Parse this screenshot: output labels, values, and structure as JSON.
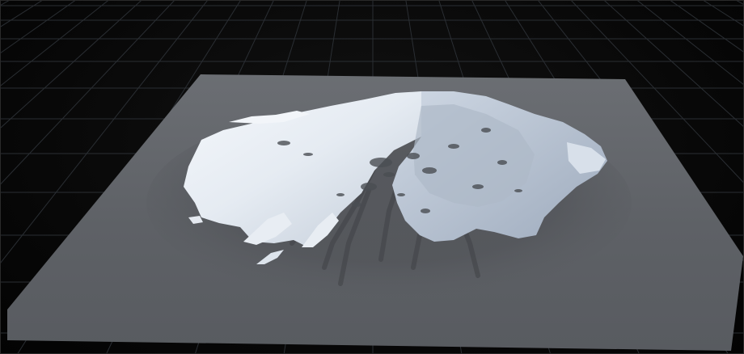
{
  "viewport": {
    "background_color": "#050505",
    "grid_color": "#2a2e33",
    "plane_color": "#5d6065",
    "plane_shadow_color": "#484a4e",
    "snow_color": "#e6ecf3",
    "snow_shadow_color": "#a8b4c4"
  }
}
